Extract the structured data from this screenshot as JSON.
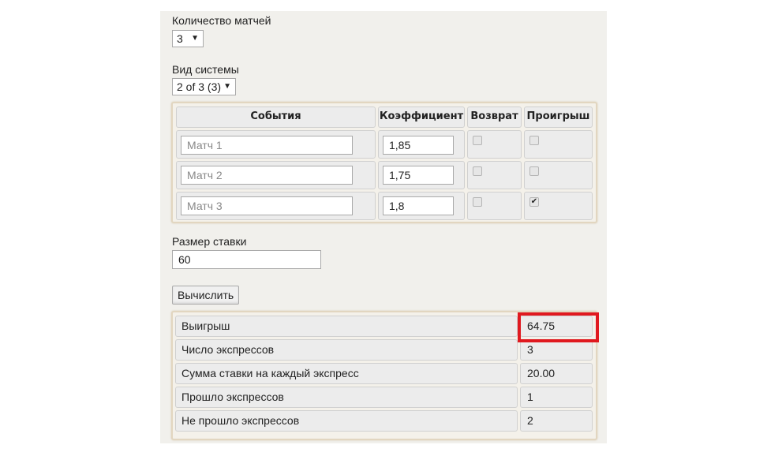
{
  "matches_count": {
    "label": "Количество матчей",
    "selected": "3"
  },
  "system_type": {
    "label": "Вид системы",
    "selected": "2 of 3 (3)"
  },
  "events_table": {
    "headers": [
      "События",
      "Коэффициент",
      "Возврат",
      "Проигрыш"
    ],
    "rows": [
      {
        "event_placeholder": "Матч 1",
        "odds": "1,85",
        "refund": false,
        "loss": false
      },
      {
        "event_placeholder": "Матч 2",
        "odds": "1,75",
        "refund": false,
        "loss": false
      },
      {
        "event_placeholder": "Матч 3",
        "odds": "1,8",
        "refund": false,
        "loss": true
      }
    ]
  },
  "stake": {
    "label": "Размер ставки",
    "value": "60"
  },
  "calculate_button": "Вычислить",
  "results": [
    {
      "label": "Выигрыш",
      "value": "64.75",
      "highlighted": true
    },
    {
      "label": "Число экспрессов",
      "value": "3"
    },
    {
      "label": "Сумма ставки на каждый экспресс",
      "value": "20.00"
    },
    {
      "label": "Прошло экспрессов",
      "value": "1"
    },
    {
      "label": "Не прошло экспрессов",
      "value": "2"
    }
  ],
  "colors": {
    "highlight": "#e0191f"
  },
  "icons": {
    "dropdown": "▼",
    "check": "✔"
  }
}
